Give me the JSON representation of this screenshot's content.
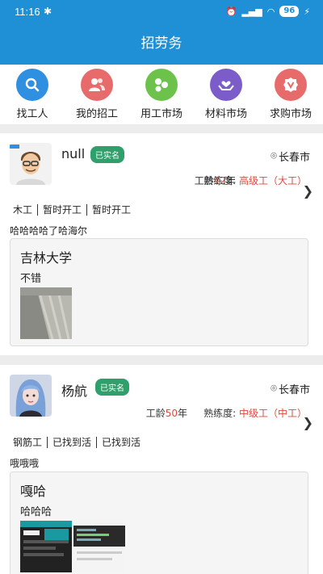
{
  "status": {
    "time": "11:16",
    "battery": "96"
  },
  "header": {
    "title": "招劳务"
  },
  "quicknav": [
    {
      "label": "找工人",
      "icon": "search-icon",
      "color": "#2f8fe0"
    },
    {
      "label": "我的招工",
      "icon": "users-icon",
      "color": "#e86b6b"
    },
    {
      "label": "用工市场",
      "icon": "dots-icon",
      "color": "#6dc24b"
    },
    {
      "label": "材料市场",
      "icon": "hands-heart-icon",
      "color": "#7b5cc9"
    },
    {
      "label": "求购市场",
      "icon": "v-badge-icon",
      "color": "#e86b6b"
    }
  ],
  "cards": [
    {
      "name": "null",
      "verified": "已实名",
      "location": "长春市",
      "exp_prefix": "工龄",
      "years": "12",
      "years_unit": "年",
      "skill_prefix": "熟练度:",
      "skill": "高级工（大工）",
      "tags": [
        "木工",
        "暂时开工",
        "暂时开工"
      ],
      "description": "哈哈哈哈了哈海尔",
      "inner_title": "吉林大学",
      "inner_subtitle": "不错"
    },
    {
      "name": "杨航",
      "verified": "已实名",
      "location": "长春市",
      "exp_prefix": "工龄",
      "years": "50",
      "years_unit": "年",
      "skill_prefix": "熟练度:",
      "skill": "中级工（中工）",
      "tags": [
        "钢筋工",
        "已找到活",
        "已找到活"
      ],
      "description": "哦哦哦",
      "inner_title": "嘎哈",
      "inner_subtitle": "哈哈哈"
    }
  ]
}
